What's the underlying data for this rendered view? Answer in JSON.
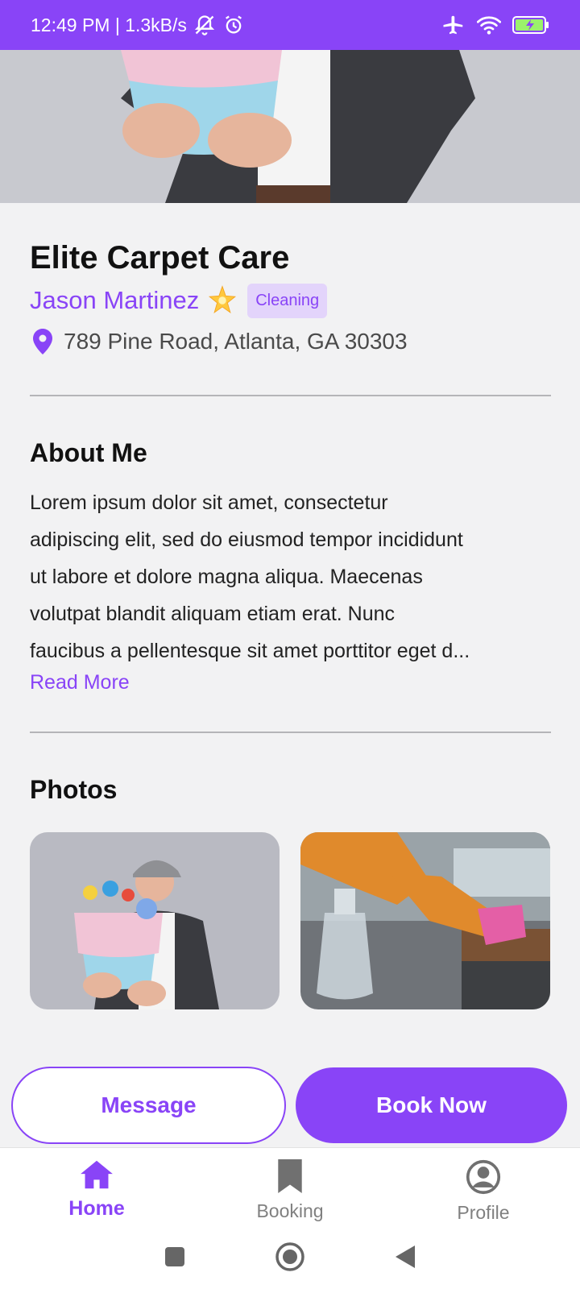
{
  "status_bar": {
    "time_speed": "12:49 PM | 1.3kB/s",
    "icons": [
      "bell-off-icon",
      "alarm-icon",
      "airplane-icon",
      "wifi-icon",
      "battery-charging-icon"
    ]
  },
  "provider": {
    "business_name": "Elite Carpet Care",
    "owner_name": "Jason Martinez",
    "category": "Cleaning",
    "address": "789 Pine Road, Atlanta, GA 30303"
  },
  "about": {
    "title": "About Me",
    "lines": [
      "Lorem ipsum dolor sit amet, consectetur",
      "adipiscing elit, sed do eiusmod tempor incididunt",
      "ut labore et dolore magna aliqua. Maecenas",
      "volutpat blandit aliquam etiam erat. Nunc",
      "faucibus a pellentesque sit amet porttitor eget d..."
    ],
    "read_more": "Read More"
  },
  "photos": {
    "title": "Photos"
  },
  "actions": {
    "message": "Message",
    "book": "Book Now"
  },
  "bottom_nav": {
    "items": [
      {
        "label": "Home",
        "icon": "home-icon",
        "active": true
      },
      {
        "label": "Booking",
        "icon": "bookmark-icon",
        "active": false
      },
      {
        "label": "Profile",
        "icon": "profile-icon",
        "active": false
      }
    ]
  },
  "colors": {
    "accent": "#8944f7",
    "badge_bg": "#e3d4fb",
    "background": "#f2f2f3"
  }
}
